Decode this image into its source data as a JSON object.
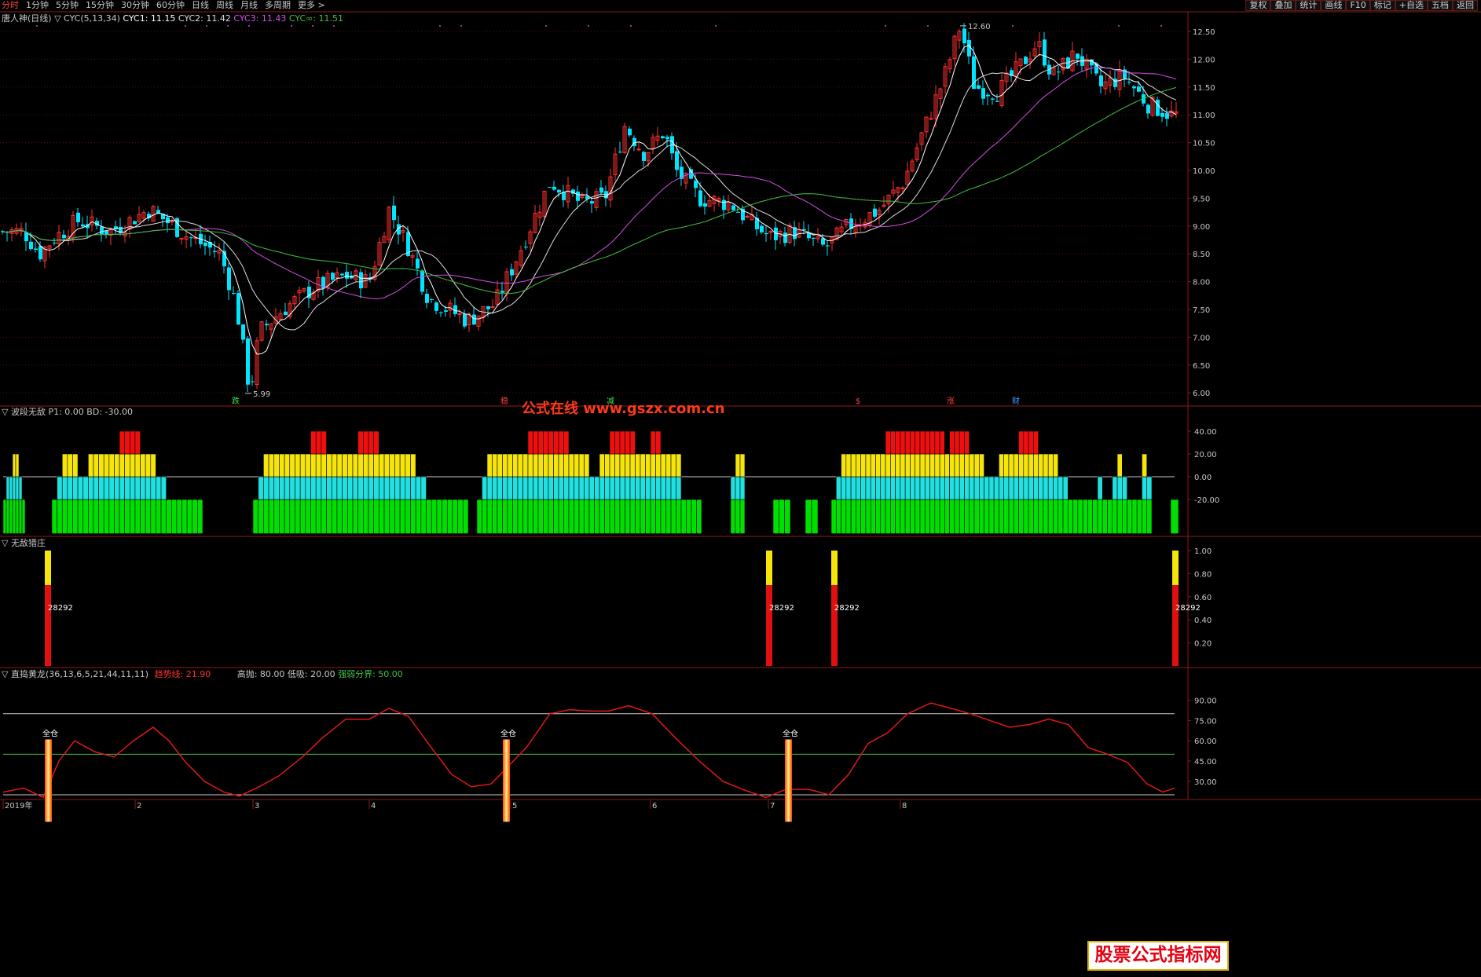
{
  "toolbar": {
    "periods": [
      "分时",
      "1分钟",
      "5分钟",
      "15分钟",
      "30分钟",
      "60分钟",
      "日线",
      "周线",
      "月线",
      "多周期",
      "更多 >"
    ],
    "active_index": 0,
    "buttons": [
      "复权",
      "叠加",
      "统计",
      "画线",
      "F10",
      "标记",
      "+自选",
      "五档",
      "返回"
    ]
  },
  "main_panel": {
    "stock_name": "唐人神(日线)",
    "indicator": "▽ CYC(5,13,34)",
    "cyc1": "CYC1: 11.15",
    "cyc2": "CYC2: 11.42",
    "cyc3": "CYC3: 11.43",
    "cycinf": "CYC∞: 11.51",
    "y_ticks": [
      "12.50",
      "12.00",
      "11.50",
      "11.00",
      "10.50",
      "10.00",
      "9.50",
      "9.00",
      "8.50",
      "8.00",
      "7.50",
      "7.00",
      "6.50",
      "6.00"
    ],
    "high_label": "12.60",
    "low_label": "5.99",
    "signals": [
      "跌",
      "稳",
      "减",
      "$",
      "涨",
      "财"
    ],
    "colors": {
      "up": "#ff3030",
      "down": "#00e5ff",
      "cyc1": "#ffffff",
      "cyc2": "#dddddd",
      "cyc3": "#d54ee8",
      "cycinf": "#40c040"
    }
  },
  "watermark": "公式在线 www.gszx.com.cn",
  "panel2": {
    "title": "▽ 波段无敌",
    "p1": "P1: 0.00",
    "bd": "BD: -30.00",
    "y_ticks": [
      "40.00",
      "20.00",
      "0.00",
      "-20.00"
    ]
  },
  "panel3": {
    "title": "▽ 无敌猎庄",
    "bar_label": "28292",
    "y_ticks": [
      "1.00",
      "0.80",
      "0.60",
      "0.40",
      "0.20"
    ]
  },
  "panel4": {
    "title": "▽ 直捣黄龙(36,13,6,5,21,44,11,11)",
    "trend": "趋势线: 21.90",
    "high": "高抛: 80.00",
    "low": "低吸: 20.00",
    "split": "强弱分界: 50.00",
    "full_label": "全仓",
    "y_ticks": [
      "90.00",
      "75.00",
      "60.00",
      "45.00",
      "30.00"
    ]
  },
  "xaxis": {
    "labels": [
      "2019年",
      "2",
      "3",
      "4",
      "5",
      "6",
      "7",
      "8"
    ]
  },
  "logo": "股票公式指标网"
}
